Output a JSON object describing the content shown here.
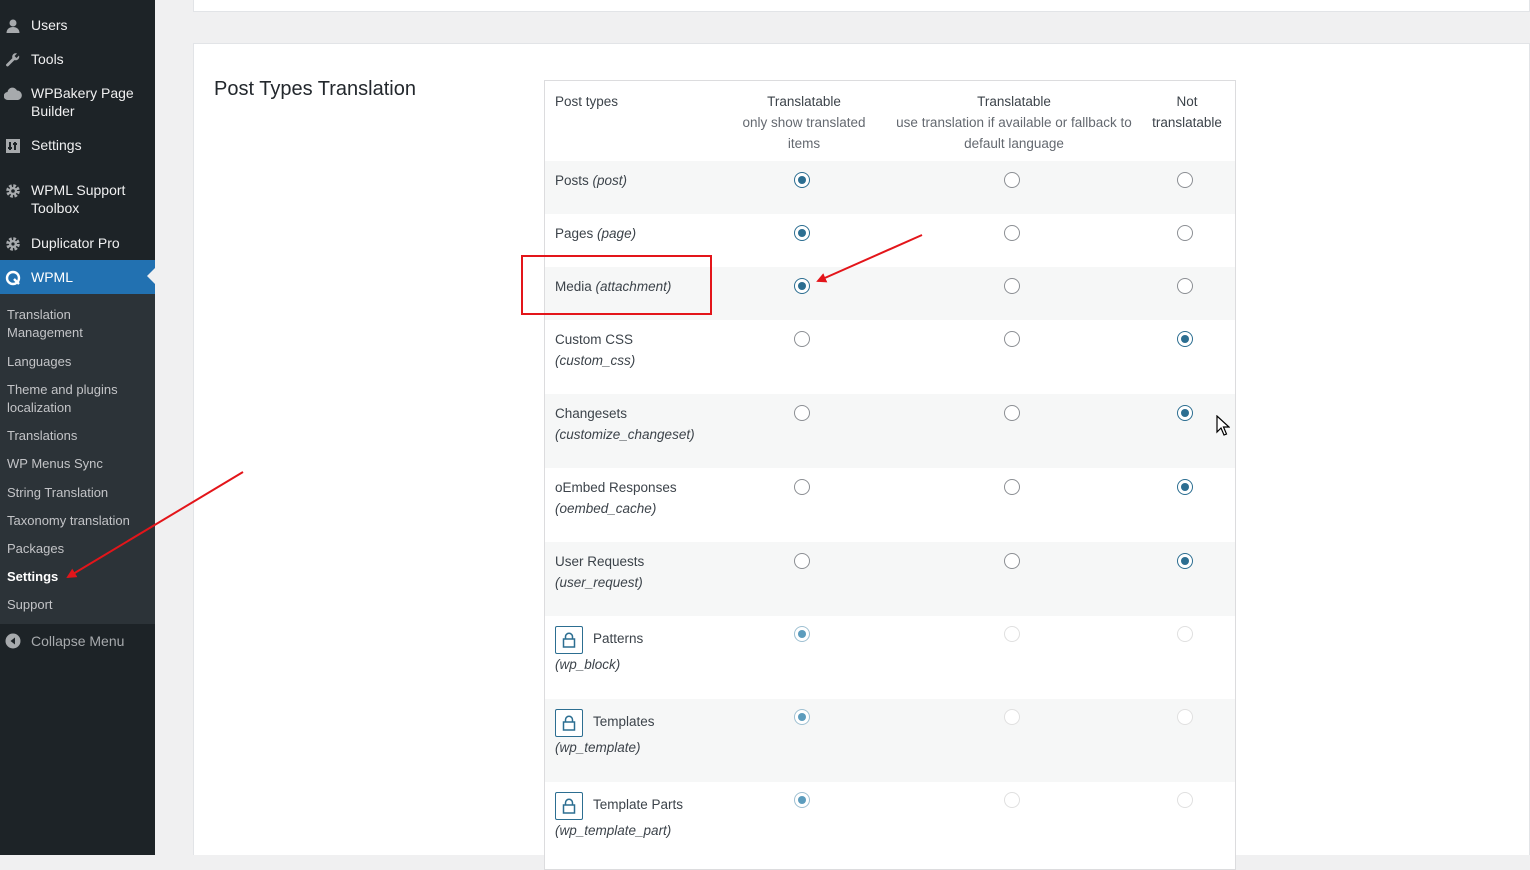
{
  "sidebar": {
    "items": [
      {
        "label": "Users",
        "icon": "user-icon"
      },
      {
        "label": "Tools",
        "icon": "wrench-icon"
      },
      {
        "label": "WPBakery Page Builder",
        "icon": "cloud-icon"
      },
      {
        "label": "Settings",
        "icon": "settings-icon"
      },
      {
        "label": "WPML Support Toolbox",
        "icon": "gear-icon"
      },
      {
        "label": "Duplicator Pro",
        "icon": "duplicator-icon"
      },
      {
        "label": "WPML",
        "icon": "wpml-icon"
      }
    ],
    "submenu": [
      {
        "label": "Translation Management"
      },
      {
        "label": "Languages"
      },
      {
        "label": "Theme and plugins localization"
      },
      {
        "label": "Translations"
      },
      {
        "label": "WP Menus Sync"
      },
      {
        "label": "String Translation"
      },
      {
        "label": "Taxonomy translation"
      },
      {
        "label": "Packages"
      },
      {
        "label": "Settings"
      },
      {
        "label": "Support"
      }
    ],
    "collapse_label": "Collapse Menu"
  },
  "section": {
    "title": "Post Types Translation"
  },
  "table": {
    "headers": {
      "post_types": "Post types",
      "col1_title": "Translatable",
      "col1_sub": "only show translated items",
      "col2_title": "Translatable",
      "col2_sub": "use translation if available or fallback to default language",
      "col3": "Not translatable"
    },
    "rows": [
      {
        "name": "Posts",
        "slug": "(post)",
        "selected": 1,
        "locked": false
      },
      {
        "name": "Pages",
        "slug": "(page)",
        "selected": 1,
        "locked": false
      },
      {
        "name": "Media",
        "slug": "(attachment)",
        "selected": 1,
        "locked": false
      },
      {
        "name": "Custom CSS",
        "slug": "(custom_css)",
        "selected": 3,
        "locked": false
      },
      {
        "name": "Changesets",
        "slug": "(customize_changeset)",
        "selected": 3,
        "locked": false
      },
      {
        "name": "oEmbed Responses",
        "slug": "(oembed_cache)",
        "selected": 3,
        "locked": false
      },
      {
        "name": "User Requests",
        "slug": "(user_request)",
        "selected": 3,
        "locked": false
      },
      {
        "name": "Patterns",
        "slug": "(wp_block)",
        "selected": 1,
        "locked": true
      },
      {
        "name": "Templates",
        "slug": "(wp_template)",
        "selected": 1,
        "locked": true
      },
      {
        "name": "Template Parts",
        "slug": "(wp_template_part)",
        "selected": 1,
        "locked": true
      }
    ]
  },
  "colors": {
    "sidebar_bg": "#1d2327",
    "submenu_bg": "#2c3338",
    "active_item": "#2271b1",
    "radio_checked": "#2c6e91",
    "annotation_red": "#e3151a"
  }
}
